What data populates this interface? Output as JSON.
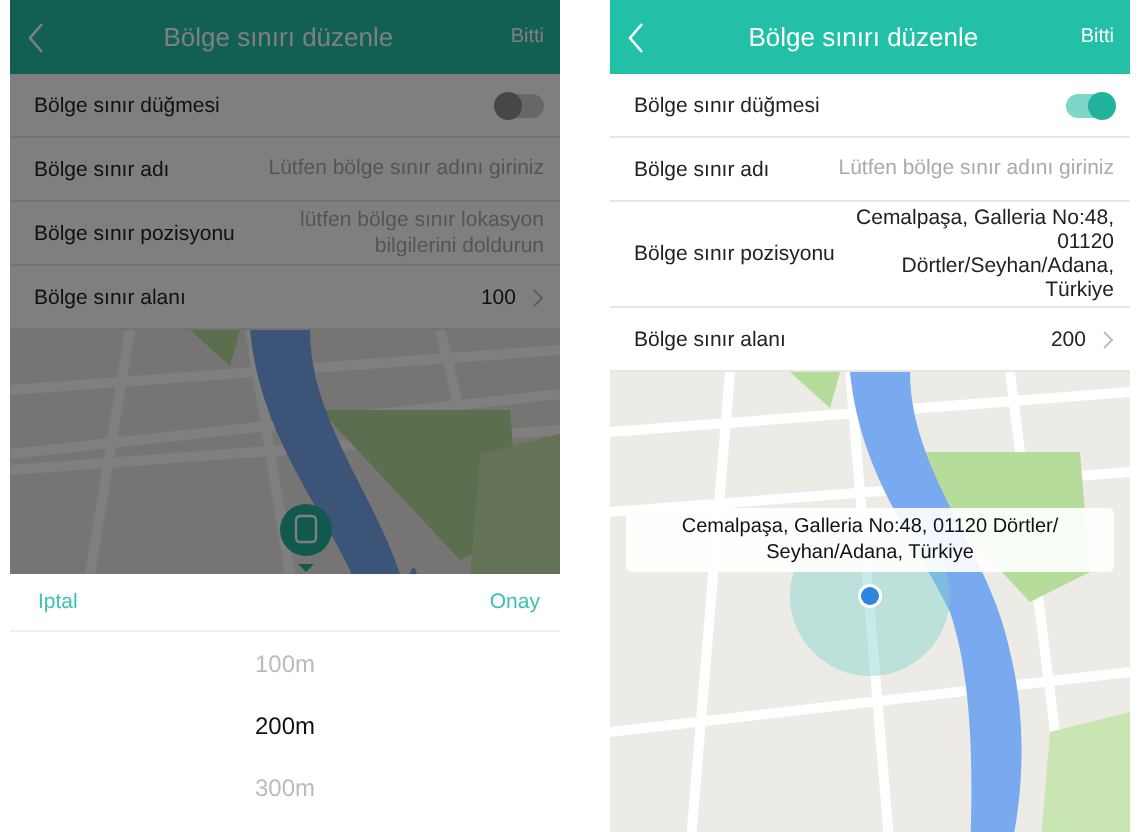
{
  "screens": [
    {
      "dimmed": true,
      "header": {
        "title": "Bölge sınırı düzenle",
        "action": "Bitti"
      },
      "rows": [
        {
          "kind": "toggle",
          "label": "Bölge sınır düğmesi",
          "on": false
        },
        {
          "kind": "text",
          "label": "Bölge sınır adı",
          "placeholder": "Lütfen bölge sınır adını giriniz"
        },
        {
          "kind": "text",
          "label": "Bölge sınır pozisyonu",
          "placeholder": "lütfen bölge sınır lokasyon bilgilerini doldurun"
        },
        {
          "kind": "select",
          "label": "Bölge sınır alanı",
          "value": "100"
        }
      ],
      "map": {
        "kind": "marker"
      },
      "picker": {
        "cancel": "Iptal",
        "confirm": "Onay",
        "options": [
          {
            "label": "100m",
            "selected": false
          },
          {
            "label": "200m",
            "selected": true
          },
          {
            "label": "300m",
            "selected": false
          }
        ]
      }
    },
    {
      "dimmed": false,
      "header": {
        "title": "Bölge sınırı düzenle",
        "action": "Bitti"
      },
      "rows": [
        {
          "kind": "toggle",
          "label": "Bölge sınır düğmesi",
          "on": true
        },
        {
          "kind": "text",
          "label": "Bölge sınır adı",
          "placeholder": "Lütfen bölge sınır adını giriniz"
        },
        {
          "kind": "text",
          "label": "Bölge sınır pozisyonu",
          "value": "Cemalpaşa, Galleria No:48, 01120 Dörtler/Seyhan/Adana, Türkiye"
        },
        {
          "kind": "select",
          "label": "Bölge sınır alanı",
          "value": "200"
        }
      ],
      "map": {
        "kind": "radius",
        "callout": "Cemalpaşa, Galleria No:48, 01120 Dörtler/ Seyhan/Adana, Türkiye"
      }
    }
  ]
}
